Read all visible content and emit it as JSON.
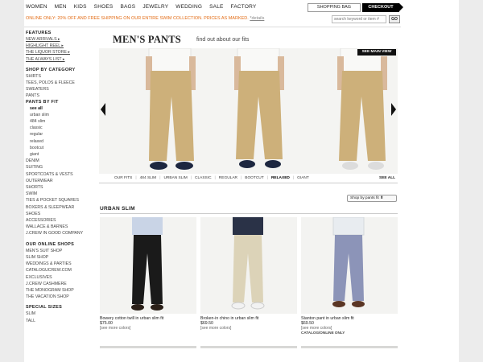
{
  "nav": [
    "WOMEN",
    "MEN",
    "KIDS",
    "SHOES",
    "BAGS",
    "JEWELRY",
    "WEDDING",
    "SALE",
    "FACTORY"
  ],
  "bag_label": "SHOPPING BAG",
  "checkout_label": "CHECKOUT",
  "promo": "ONLINE ONLY: 20% OFF AND FREE SHIPPING ON OUR ENTIRE SWIM COLLECTION. PRICES AS MARKED.",
  "promo_details": "*details",
  "search_placeholder": "search keyword or item #",
  "go_label": "GO",
  "sidebar": {
    "features_head": "FEATURES",
    "features": [
      "NEW ARRIVALS ▸",
      "HIGHLIGHT REEL ▸",
      "THE LIQUOR STORE ▸",
      "THE ALWAYS LIST ▸"
    ],
    "category_head": "SHOP BY CATEGORY",
    "cat1": [
      "SHIRTS",
      "TEES, POLOS & FLEECE",
      "SWEATERS",
      "PANTS"
    ],
    "fit_head": "PANTS BY FIT",
    "fits": [
      "see all",
      "urban slim",
      "484 slim",
      "classic",
      "regular",
      "relaxed",
      "bootcut",
      "giant"
    ],
    "cat2": [
      "DENIM",
      "SUITING",
      "SPORTCOATS & VESTS",
      "OUTERWEAR",
      "SHORTS",
      "SWIM",
      "TIES & POCKET SQUARES",
      "BOXERS & SLEEPWEAR",
      "SHOES",
      "ACCESSORIES",
      "WALLACE & BARNES",
      "J.CREW IN GOOD COMPANY"
    ],
    "shops_head": "OUR ONLINE SHOPS",
    "shops": [
      "MEN'S SUIT SHOP",
      "SLIM SHOP",
      "WEDDINGS & PARTIES",
      "CATALOGUCREW.COM EXCLUSIVES",
      "J.CREW CASHMERE",
      "THE MONOGRAM SHOP",
      "THE VACATION SHOP"
    ],
    "sizes_head": "SPECIAL SIZES",
    "sizes": [
      "SLIM",
      "TALL"
    ]
  },
  "title": "MEN'S PANTS",
  "title_sub": "find out about our fits",
  "main_view": "SEE MAIN VIEW",
  "fit_bar": [
    "OUR FITS",
    "484 SLIM",
    "URBAN SLIM",
    "CLASSIC",
    "REGULAR",
    "BOOTCUT",
    "RELAXED",
    "GIANT"
  ],
  "fit_active": "RELAXED",
  "see_all": "SEE ALL",
  "sort_label": "Shop by pants fit  ⬍",
  "section": "URBAN SLIM",
  "products": [
    {
      "name": "Bowery cotton twill in urban slim fit",
      "price": "$75.00",
      "colors": "[see more colors]",
      "note": "",
      "pant": "#1a1a1a",
      "shirt": "#c9d4e6",
      "shoe": "#2a1f18"
    },
    {
      "name": "Broken-in chino in urban slim fit",
      "price": "$69.50",
      "colors": "[see more colors]",
      "note": "",
      "pant": "#dcd3b8",
      "shirt": "#2a3247",
      "shoe": "#f2f2f2"
    },
    {
      "name": "Stanton pant in urban slim fit",
      "price": "$69.50",
      "colors": "[see more colors]",
      "note": "CATALOG/ONLINE ONLY",
      "pant": "#8c94b8",
      "shirt": "#e8ecf0",
      "shoe": "#5a3524"
    }
  ],
  "colors": {
    "promo": "#e36b14",
    "hero_pant": "#cdb07a",
    "hero_shirt": "#f7f7f5"
  }
}
